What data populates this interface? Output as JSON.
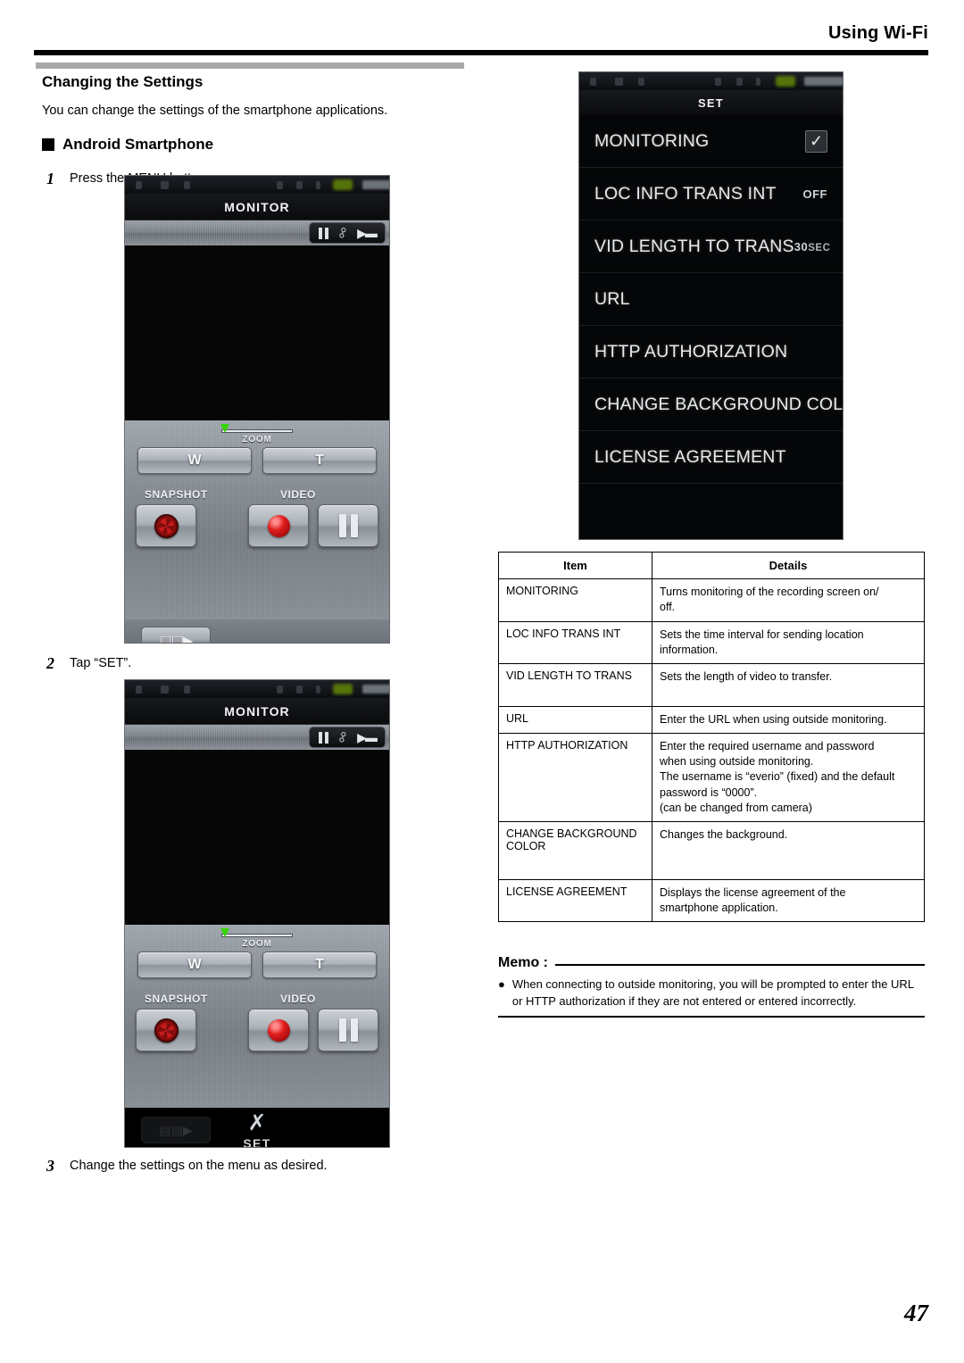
{
  "header": {
    "title": "Using Wi-Fi"
  },
  "left": {
    "section_title": "Changing the Settings",
    "intro": "You can change the settings of the smartphone applications.",
    "block_heading": "Android Smartphone",
    "steps": [
      {
        "num": "1",
        "text": "Press the MENU button."
      },
      {
        "num": "2",
        "text": "Tap “SET”."
      },
      {
        "num": "3",
        "text": "Change the settings on the menu as desired."
      }
    ]
  },
  "phone_monitor": {
    "title": "MONITOR",
    "zoom_label": "ZOOM",
    "wide_label": "W",
    "tele_label": "T",
    "snapshot_label": "SNAPSHOT",
    "video_label": "VIDEO",
    "menu_icon": "menu-grid-icon",
    "pause_icon": "pause-icon",
    "link_icon": "link-icon",
    "plug_icon": "plug-icon",
    "record_icon": "record-icon",
    "iris_icon": "iris-shutter-icon"
  },
  "phone_monitor_set": {
    "title": "MONITOR",
    "zoom_label": "ZOOM",
    "wide_label": "W",
    "tele_label": "T",
    "snapshot_label": "SNAPSHOT",
    "video_label": "VIDEO",
    "set_label": "SET",
    "set_icon": "wrench-screwdriver-icon"
  },
  "set_panel": {
    "title": "SET",
    "rows": [
      {
        "label": "MONITORING",
        "value": "",
        "control": "checkbox",
        "checked": true
      },
      {
        "label": "LOC INFO TRANS INT",
        "value": "OFF",
        "control": "value"
      },
      {
        "label": "VID LENGTH TO TRANS",
        "value": "30",
        "value_unit": "SEC",
        "control": "value"
      },
      {
        "label": "URL",
        "value": "",
        "control": "none"
      },
      {
        "label": "HTTP AUTHORIZATION",
        "value": "",
        "control": "none"
      },
      {
        "label": "CHANGE BACKGROUND COL",
        "value": "",
        "control": "none"
      },
      {
        "label": "LICENSE AGREEMENT",
        "value": "",
        "control": "none"
      }
    ]
  },
  "table": {
    "headers": {
      "item": "Item",
      "details": "Details"
    },
    "rows": [
      {
        "item": "MONITORING",
        "details": [
          "Turns monitoring of the recording screen on/",
          "off."
        ]
      },
      {
        "item": "LOC INFO TRANS INT",
        "details": [
          "Sets the time interval for sending location",
          "information."
        ]
      },
      {
        "item": "VID LENGTH TO TRANS",
        "details": [
          "Sets the length of video to transfer."
        ]
      },
      {
        "item": "URL",
        "details": [
          "Enter the URL when using outside monitoring."
        ]
      },
      {
        "item": "HTTP AUTHORIZATION",
        "details": [
          "Enter the required username and password",
          "when using outside monitoring.",
          "The username is “everio” (fixed) and the default",
          "password is “0000”.",
          "(can be changed from camera)"
        ]
      },
      {
        "item": "CHANGE BACKGROUND COLOR",
        "details": [
          "Changes the background."
        ]
      },
      {
        "item": "LICENSE AGREEMENT",
        "details": [
          "Displays the license agreement of the",
          "smartphone application."
        ]
      }
    ]
  },
  "memo": {
    "label": "Memo :",
    "bullet": "●",
    "text": "When connecting to outside monitoring, you will be prompted to enter the URL or HTTP authorization if they are not entered or entered incorrectly."
  },
  "page_number": "47"
}
